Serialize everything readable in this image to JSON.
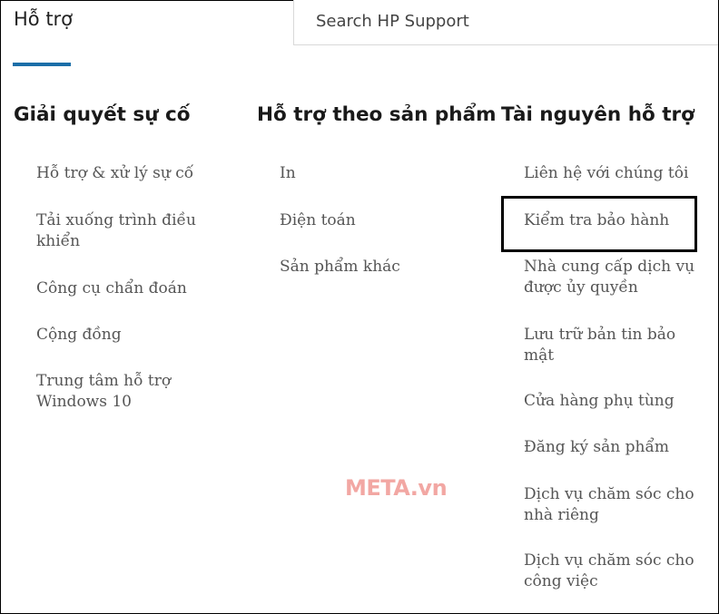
{
  "header": {
    "tab_title": "Hỗ trợ",
    "search_placeholder": "Search HP Support",
    "search_value": ""
  },
  "columns": [
    {
      "heading": "Giải quyết sự cố",
      "items": [
        "Hỗ trợ & xử lý sự cố",
        "Tải xuống trình điều khiển",
        "Công cụ chẩn đoán",
        "Cộng đồng",
        "Trung tâm hỗ trợ Windows 10"
      ]
    },
    {
      "heading": "Hỗ trợ theo sản phẩm",
      "items": [
        "In",
        "Điện toán",
        "Sản phẩm khác"
      ]
    },
    {
      "heading": "Tài nguyên hỗ trợ",
      "items": [
        "Liên hệ với chúng tôi",
        "Kiểm tra bảo hành",
        "Nhà cung cấp dịch vụ được ủy quyền",
        "Lưu trữ bản tin bảo mật",
        "Cửa hàng phụ tùng",
        "Đăng ký sản phẩm",
        "Dịch vụ chăm sóc cho nhà riêng",
        "Dịch vụ chăm sóc cho công việc"
      ]
    }
  ],
  "watermark": "META.vn",
  "colors": {
    "accent_underline": "#1b6ea8",
    "link_text": "#555555",
    "watermark": "#f2a7a3"
  }
}
